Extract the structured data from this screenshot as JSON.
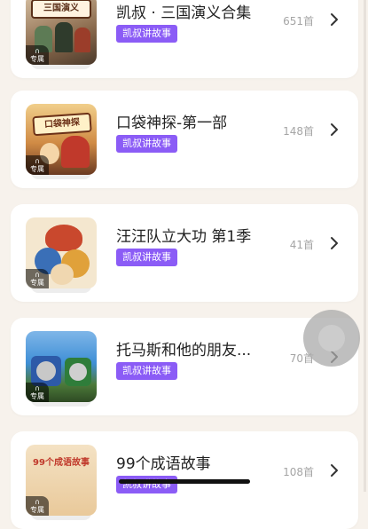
{
  "items": [
    {
      "title": "凯叔 · 三国演义合集",
      "tag": "凯叔讲故事",
      "count": "651首",
      "badge": "专属",
      "cover_text": "三国演义",
      "cover_colors": [
        "#c9a98a",
        "#6b4b34"
      ]
    },
    {
      "title": "口袋神探-第一部",
      "tag": "凯叔讲故事",
      "count": "148首",
      "badge": "专属",
      "cover_text": "口袋神探",
      "cover_colors": [
        "#e5b86a",
        "#7a3e22"
      ]
    },
    {
      "title": "汪汪队立大功 第1季",
      "tag": "凯叔讲故事",
      "count": "41首",
      "badge": "专属",
      "cover_text": "",
      "cover_colors": [
        "#f3e4c8",
        "#c6392b"
      ]
    },
    {
      "title": "托马斯和他的朋友...",
      "tag": "凯叔讲故事",
      "count": "70首",
      "badge": "专属",
      "cover_text": "",
      "cover_colors": [
        "#3f8fd6",
        "#2f5f2e"
      ]
    },
    {
      "title": "99个成语故事",
      "tag": "凯叔讲故事",
      "count": "108首",
      "badge": "专属",
      "cover_text": "99个成语故事",
      "cover_colors": [
        "#f2dfc0",
        "#d85c3b"
      ]
    }
  ],
  "colors": {
    "tag_bg": "#8b5cf6",
    "background": "#f7f2ec"
  },
  "icons": {
    "chevron": "chevron-right-icon",
    "badge": "headphones-icon",
    "floating": "assistive-touch-icon"
  }
}
